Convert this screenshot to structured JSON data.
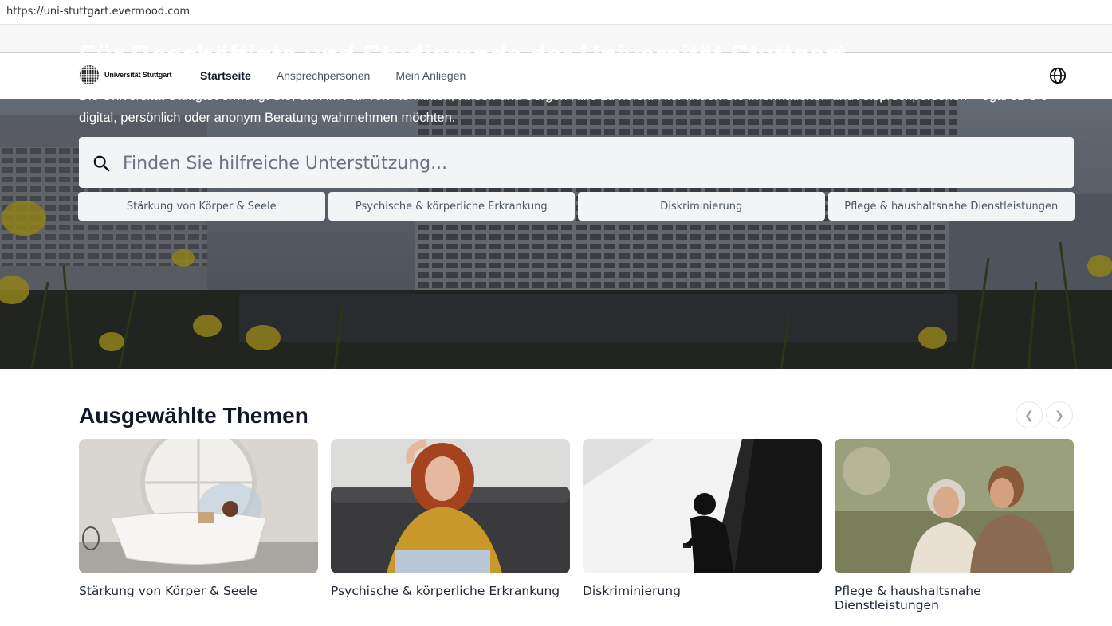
{
  "browser": {
    "url": "https://uni-stuttgart.evermood.com"
  },
  "header": {
    "logo_text": "Universität Stuttgart",
    "nav": [
      {
        "label": "Startseite",
        "active": true
      },
      {
        "label": "Ansprechpersonen",
        "active": false
      },
      {
        "label": "Mein Anliegen",
        "active": false
      }
    ],
    "language_icon": "globe-icon"
  },
  "hero": {
    "title": "Für Beschäftigte und Studierende der Universität Stuttgart",
    "description": "Die Universität Stuttgart ermutigt Sie, sich im Fall von Konflikten, Krisen und Sorgen Hilfe zu holen. Hier finden Sie Informationen und Ansprechpersonen – egal ob Sie digital, persönlich oder anonym Beratung wahrnehmen möchten.",
    "search": {
      "placeholder": "Finden Sie hilfreiche Unterstützung...",
      "value": "",
      "icon": "search-icon"
    },
    "chips": [
      "Stärkung von Körper & Seele",
      "Psychische & körperliche Erkrankung",
      "Diskriminierung",
      "Pflege & haushaltsnahe Dienstleistungen"
    ]
  },
  "themes": {
    "title": "Ausgewählte Themen",
    "prev_icon": "chevron-left-icon",
    "next_icon": "chevron-right-icon",
    "cards": [
      {
        "label": "Stärkung von Körper & Seele"
      },
      {
        "label": "Psychische & körperliche Erkrankung"
      },
      {
        "label": "Diskriminierung"
      },
      {
        "label": "Pflege & haushaltsnahe Dienstleistungen"
      }
    ]
  },
  "colors": {
    "chip_bg": "#f3f4f6",
    "text_dark": "#111827",
    "text_muted": "#4b5563"
  }
}
